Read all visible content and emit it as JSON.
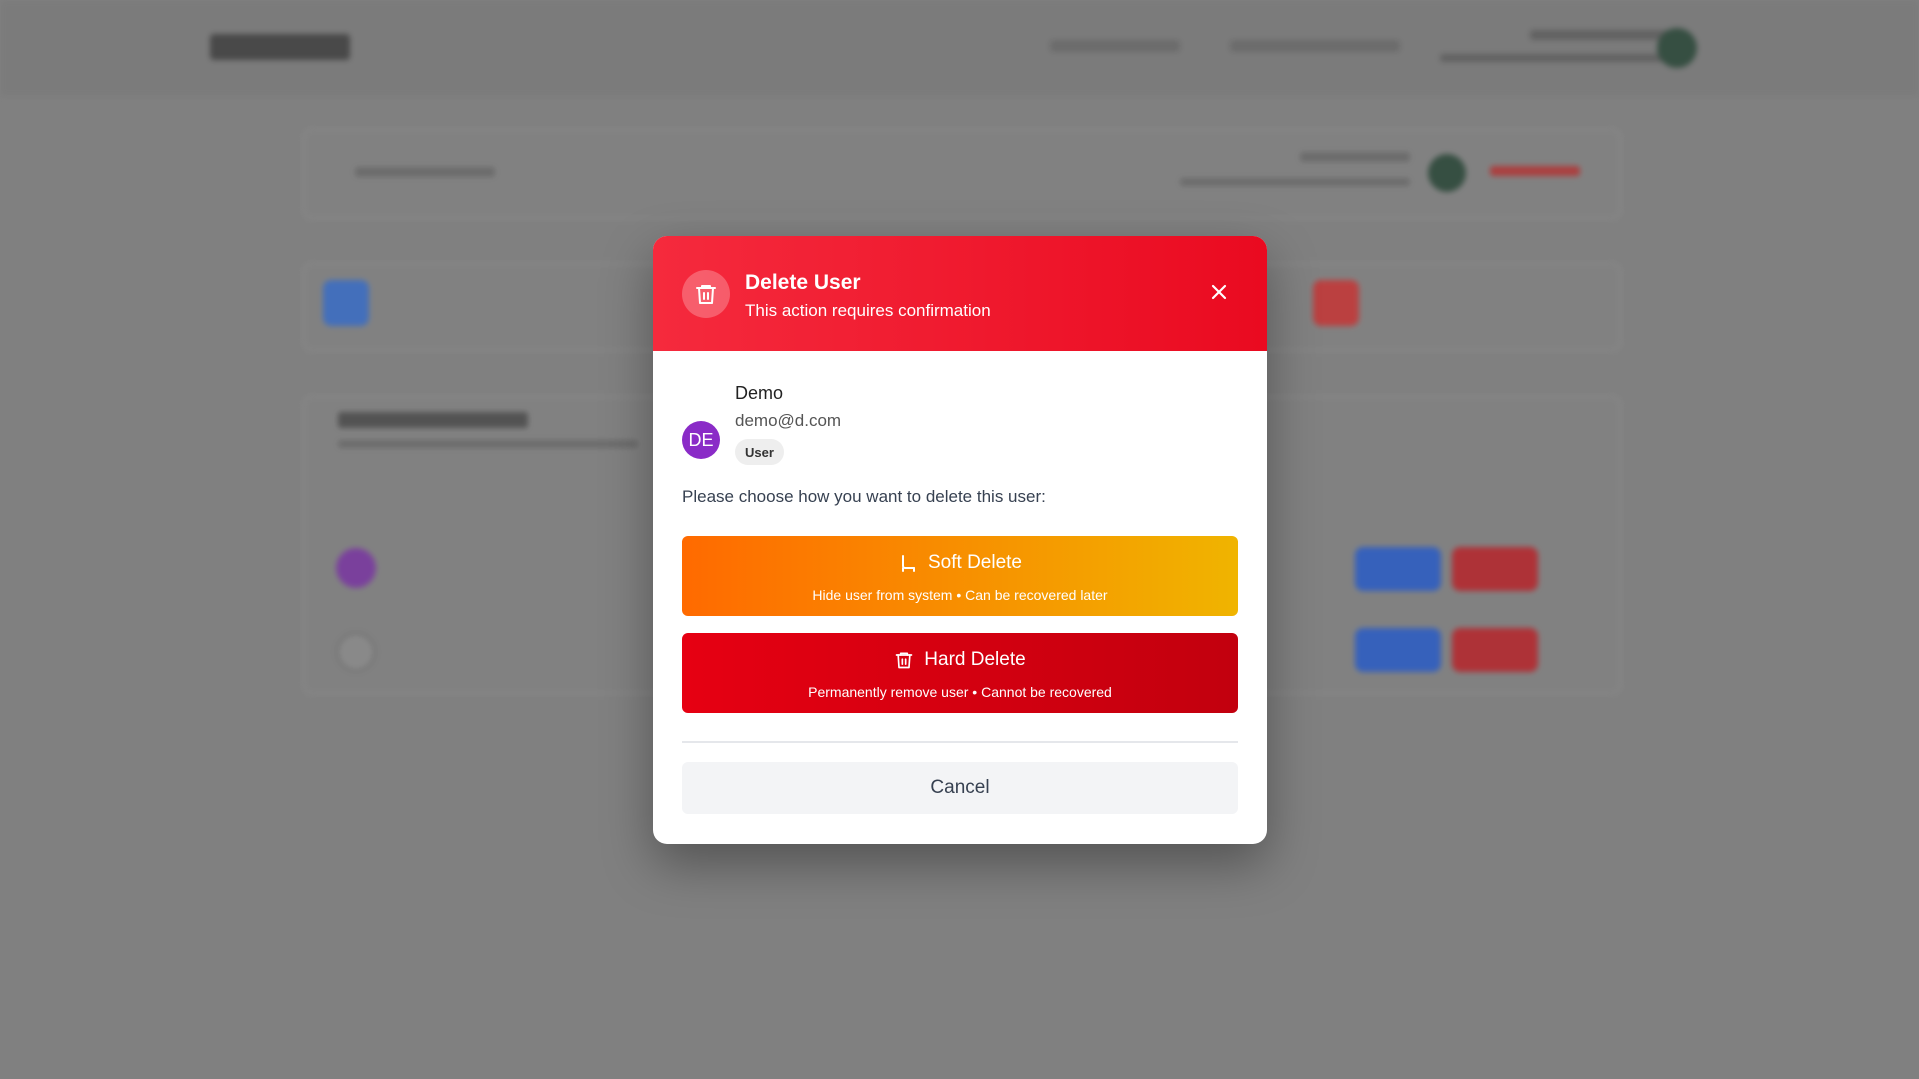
{
  "modal": {
    "title": "Delete User",
    "subtitle": "This action requires confirmation",
    "accent_color": "#ea0a20"
  },
  "user": {
    "initials": "DE",
    "name": "Demo",
    "email": "demo@d.com",
    "role": "User",
    "avatar_color": "#8a2bc7"
  },
  "prompt": "Please choose how you want to delete this user:",
  "soft_delete": {
    "label": "Soft Delete",
    "description": "Hide user from system • Can be recovered later",
    "icon": "armchair-icon"
  },
  "hard_delete": {
    "label": "Hard Delete",
    "description": "Permanently remove user • Cannot be recovered",
    "icon": "trash-icon"
  },
  "cancel_label": "Cancel"
}
